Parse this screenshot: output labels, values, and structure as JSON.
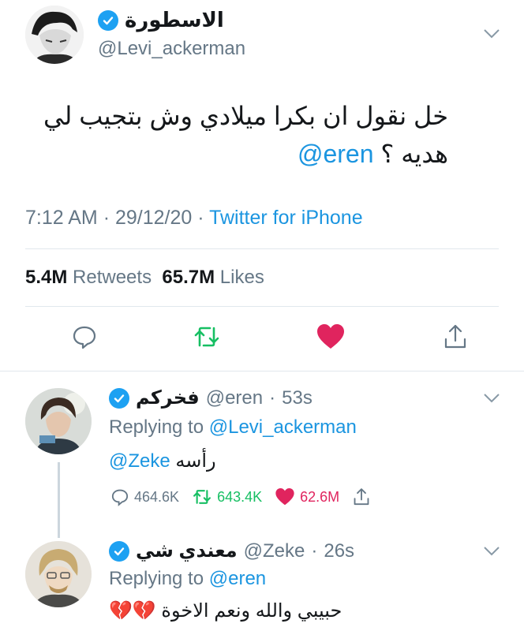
{
  "main_tweet": {
    "display_name": "الاسطورة",
    "handle": "@Levi_ackerman",
    "text_line1": "خل نقول ان بكرا ميلادي وش بتجيب لي",
    "text_line2_prefix": "هديه ؟ ",
    "text_mention": "@eren",
    "time": "7:12 AM",
    "date": "29/12/20",
    "source": "Twitter for iPhone",
    "retweets_count": "5.4M",
    "retweets_label": "Retweets",
    "likes_count": "65.7M",
    "likes_label": "Likes"
  },
  "replies": [
    {
      "display_name": "فخركم",
      "handle": "@eren",
      "age": "53s",
      "replying_label": "Replying to",
      "replying_to": "@Levi_ackerman",
      "text_prefix": "رأسه ",
      "text_mention": "@Zeke",
      "replies_count": "464.6K",
      "retweets_count": "643.4K",
      "likes_count": "62.6M"
    },
    {
      "display_name": "معندي شي",
      "handle": "@Zeke",
      "age": "26s",
      "replying_label": "Replying to",
      "replying_to": "@eren",
      "text": "حبيبي والله ونعم الاخوة 💔💔"
    }
  ],
  "colors": {
    "accent": "#1b95e0",
    "verified": "#1da1f2",
    "retweet": "#17bf63",
    "like": "#e0245e",
    "muted": "#657786"
  },
  "icons": {
    "verified": "verified-badge-icon",
    "chevron": "chevron-down-icon",
    "reply": "reply-icon",
    "retweet": "retweet-icon",
    "like": "heart-icon",
    "share": "share-icon"
  }
}
